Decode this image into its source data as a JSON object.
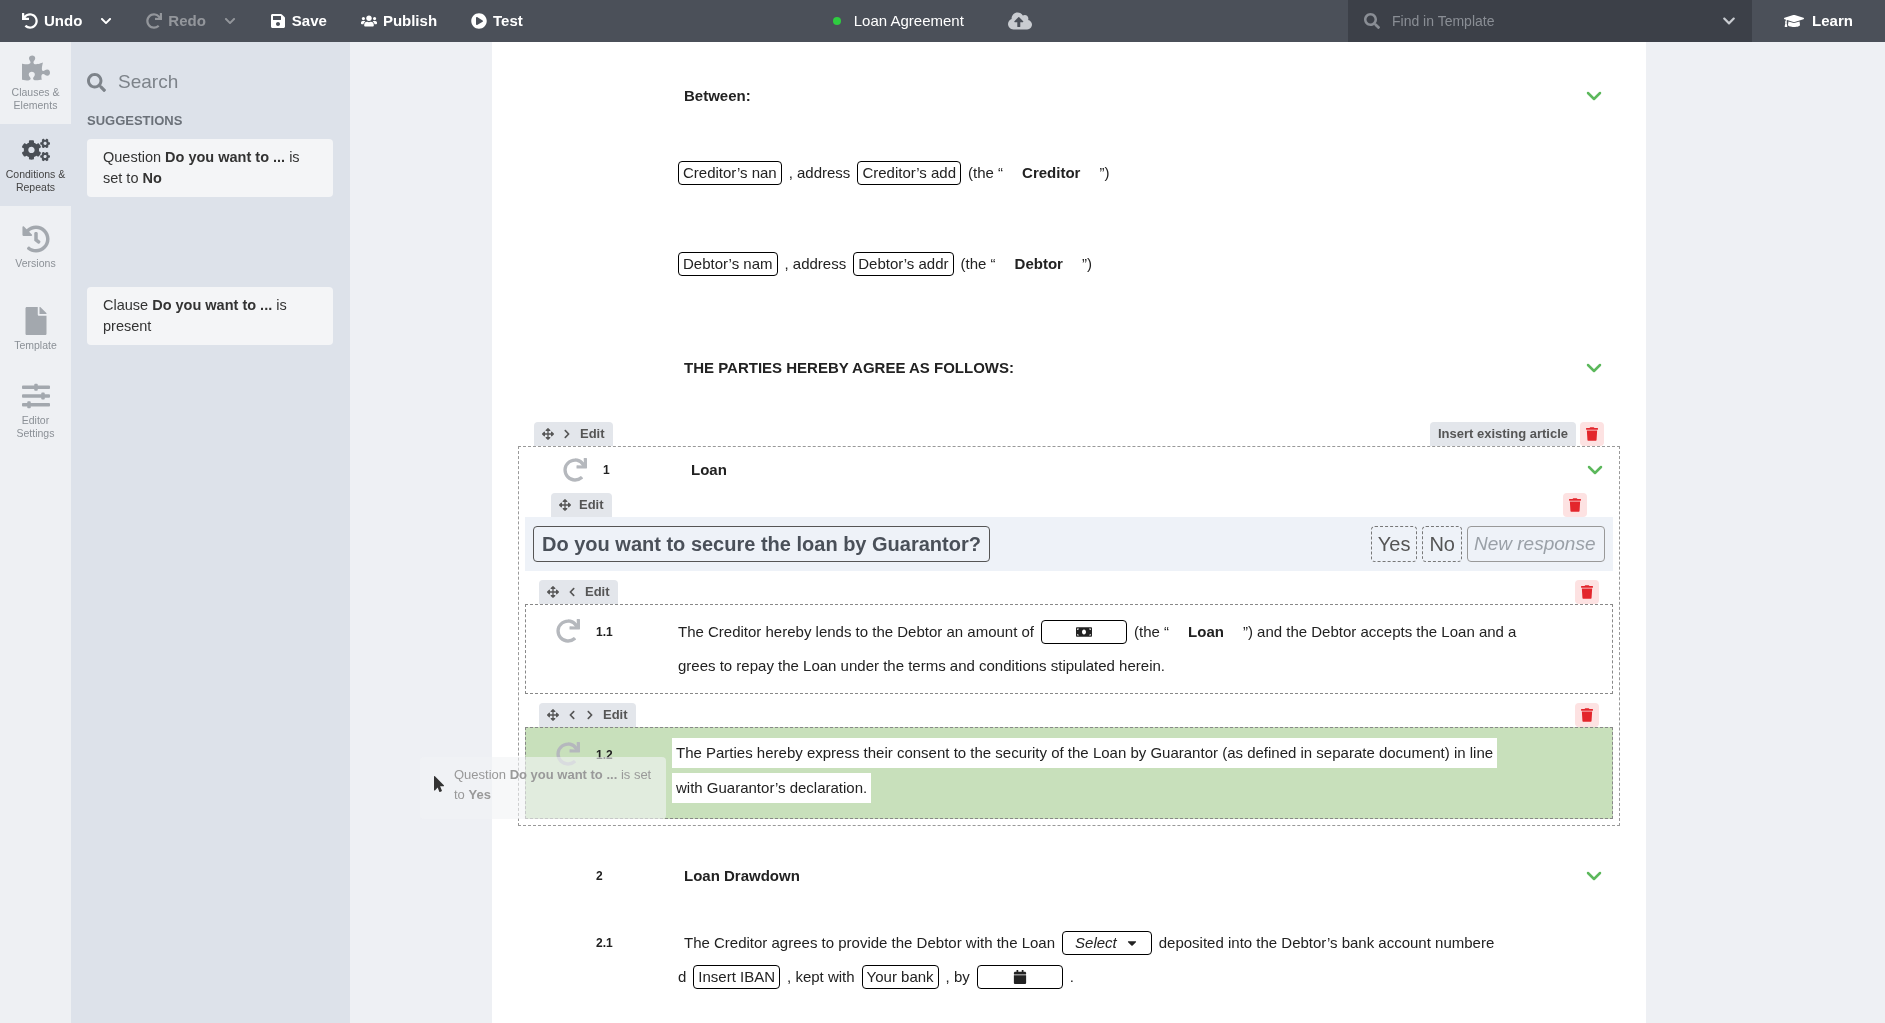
{
  "toolbar": {
    "actions": [
      {
        "kind": "undo",
        "label": "Undo",
        "disabled": false,
        "caret": true
      },
      {
        "kind": "redo",
        "label": "Redo",
        "disabled": true,
        "caret": true
      },
      {
        "kind": "save",
        "label": "Save",
        "disabled": false,
        "caret": false
      },
      {
        "kind": "publish",
        "label": "Publish",
        "disabled": false,
        "caret": false
      },
      {
        "kind": "test",
        "label": "Test",
        "disabled": false,
        "caret": false
      }
    ],
    "document": {
      "title": "Loan Agreement",
      "color": "#2ecc40"
    },
    "search": {
      "placeholder": "Find in Template"
    },
    "learn": "Learn"
  },
  "rail": [
    {
      "kind": "puzzle",
      "label": "Clauses & Elements",
      "selected": false
    },
    {
      "kind": "gears",
      "label": "Conditions & Repeats",
      "selected": true
    },
    {
      "kind": "history",
      "label": "Versions",
      "selected": false
    },
    {
      "kind": "file",
      "label": "Template",
      "selected": false
    },
    {
      "kind": "sliders",
      "label": "Editor Settings",
      "selected": false
    }
  ],
  "panel": {
    "search": {
      "placeholder": "Search"
    },
    "heading": "SUGGESTIONS",
    "suggestions": [
      {
        "text": "Question **Do you want to ...** is set to **No**"
      },
      {
        "text": "Clause **Do you want to ...** is present"
      }
    ]
  },
  "document": {
    "blocks": [
      {
        "kind": "heading",
        "text": "Between:"
      },
      {
        "kind": "line",
        "segments": [
          {
            "kind": "field",
            "value": "Creditor’s nan"
          },
          {
            "kind": "text",
            "text": ", address"
          },
          {
            "kind": "field",
            "value": "Creditor’s add"
          },
          {
            "kind": "text",
            "text": "(the “"
          },
          {
            "kind": "bold",
            "text": "Creditor"
          },
          {
            "kind": "text",
            "text": "”)"
          }
        ]
      },
      {
        "kind": "line",
        "segments": [
          {
            "kind": "field",
            "value": "Debtor’s nam"
          },
          {
            "kind": "text",
            "text": ", address"
          },
          {
            "kind": "field",
            "value": "Debtor’s addr"
          },
          {
            "kind": "text",
            "text": "(the “"
          },
          {
            "kind": "bold",
            "text": "Debtor"
          },
          {
            "kind": "text",
            "text": "”)"
          }
        ]
      },
      {
        "kind": "heading",
        "text": "THE PARTIES HEREBY AGREE AS FOLLOWS:"
      },
      {
        "kind": "article",
        "number": "1",
        "title": "Loan",
        "repeatable": true,
        "edit": "Edit",
        "insert": "Insert existing article",
        "question": {
          "edit": "Edit",
          "text": "Do you want to secure the loan by Guarantor?",
          "answers": [
            "Yes",
            "No"
          ],
          "placeholder": "New response"
        },
        "clauses": [
          {
            "number": "1.1",
            "repeatable": true,
            "highlighted": false,
            "back": true,
            "forward": false,
            "edit": "Edit",
            "lines": [
              [
                {
                  "kind": "text",
                  "text": "The Creditor hereby lends to the Debtor an amount of"
                },
                {
                  "kind": "money"
                },
                {
                  "kind": "text",
                  "text": "(the “"
                },
                {
                  "kind": "bold",
                  "text": "Loan"
                },
                {
                  "kind": "text",
                  "text": "”) and the Debtor accepts the Loan and a"
                }
              ],
              [
                {
                  "kind": "text",
                  "text": "grees to repay the Loan under the terms and conditions stipulated herein."
                }
              ]
            ]
          },
          {
            "number": "1.2",
            "repeatable": true,
            "highlighted": true,
            "back": true,
            "forward": true,
            "edit": "Edit",
            "lines": [
              [
                {
                  "kind": "text",
                  "text": "The Parties hereby express their consent to the security of the Loan by Guarantor (as defined in separate document) in line"
                }
              ],
              [
                {
                  "kind": "text",
                  "text": "with Guarantor’s declaration."
                }
              ]
            ]
          }
        ]
      },
      {
        "kind": "section",
        "number": "2",
        "title": "Loan Drawdown",
        "clauses": [
          {
            "number": "2.1",
            "lines": [
              [
                {
                  "kind": "text",
                  "text": "The Creditor agrees to provide the Debtor with the Loan"
                },
                {
                  "kind": "select",
                  "value": "Select"
                },
                {
                  "kind": "text",
                  "text": "deposited into the Debtor’s bank account numbere"
                }
              ],
              [
                {
                  "kind": "text",
                  "text": "d"
                },
                {
                  "kind": "field",
                  "value": "Insert IBAN"
                },
                {
                  "kind": "text",
                  "text": ", kept with"
                },
                {
                  "kind": "field",
                  "value": "Your bank"
                },
                {
                  "kind": "text",
                  "text": ", by"
                },
                {
                  "kind": "date"
                },
                {
                  "kind": "text",
                  "text": "."
                }
              ]
            ]
          }
        ]
      }
    ]
  },
  "drag_preview": {
    "text": "Question **Do you want to ...** is set to **Yes**"
  }
}
